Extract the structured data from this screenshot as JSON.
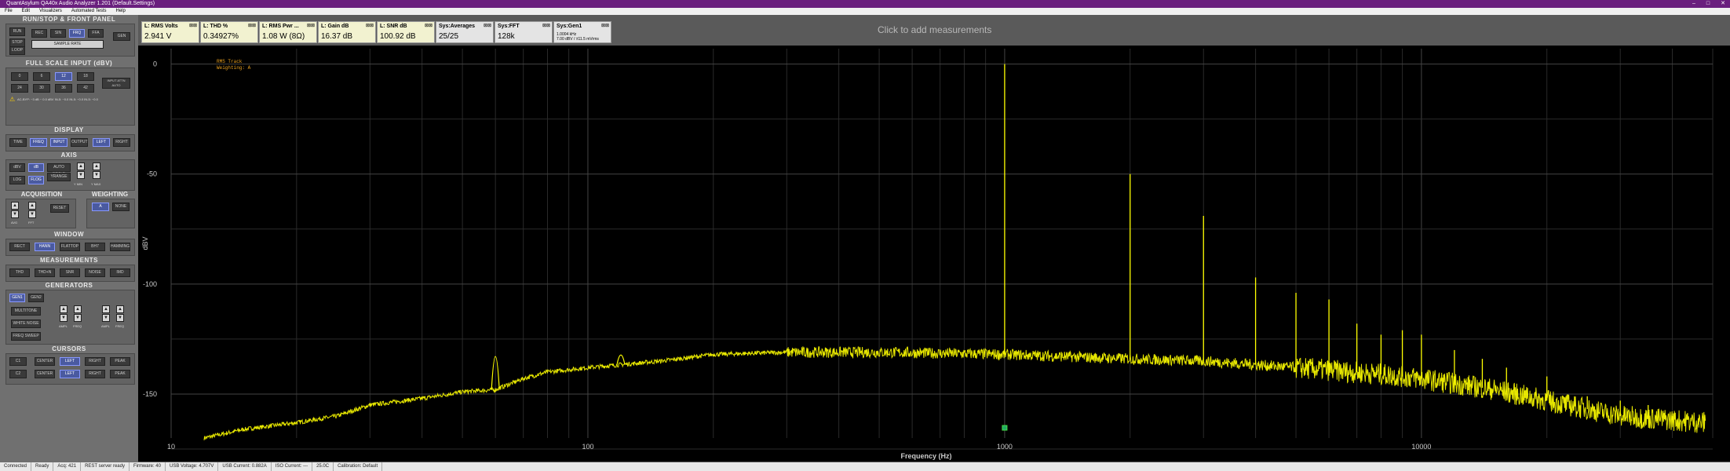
{
  "window": {
    "title": "QuantAsylum QA40x Audio Analyzer 1.201 (Default.Settings)",
    "controls": [
      "–",
      "□",
      "✕"
    ]
  },
  "menu": [
    "File",
    "Edit",
    "Visualizers",
    "Automated Tests",
    "Help"
  ],
  "left_panel": {
    "run_stop": {
      "title": "RUN/STOP & FRONT PANEL",
      "buttons": [
        "RUN",
        "REC",
        "SIN",
        "FRQ",
        "FFA",
        "GEN",
        "STOP",
        "LOOP"
      ],
      "sample_rate": "SAMPLE RATE"
    },
    "full_scale": {
      "title": "FULL SCALE INPUT (dBV)",
      "row1": [
        "0",
        "6",
        "12",
        "18"
      ],
      "row2": [
        "24",
        "30",
        "36",
        "42"
      ],
      "auto_label": "INPUT ATTN AUTO",
      "warning": "AC-BYP: ~3 dB ~ 0.0 dBV   IN-5: ~0.0   IN-5: ~0.0   IN-5: ~0.0"
    },
    "display": {
      "title": "DISPLAY",
      "buttons": [
        "TIME",
        "FREQ",
        "INPUT",
        "OUTPUT",
        "LEFT",
        "RIGHT"
      ]
    },
    "axis": {
      "title": "AXIS",
      "buttons": [
        "dBV",
        "dB",
        "LOG",
        "FLOG",
        "AUTO SCALE",
        "YRANGE"
      ],
      "spin_labels": [
        "Y MIN",
        "Y MAX"
      ]
    },
    "acquisition": {
      "title": "ACQUISITION",
      "buttons": [
        "RESET"
      ],
      "fields": [
        "AVG",
        "FFT"
      ]
    },
    "weighting": {
      "title": "WEIGHTING",
      "buttons": [
        "A",
        "NONE"
      ]
    },
    "window": {
      "title": "WINDOW",
      "buttons": [
        "RECT",
        "HANN",
        "FLATTOP",
        "BH7",
        "HAMMING"
      ]
    },
    "measurements": {
      "title": "MEASUREMENTS",
      "buttons": [
        "THD",
        "THD+N",
        "SNR",
        "NOISE",
        "IMD"
      ]
    },
    "generators": {
      "title": "GENERATORS",
      "buttons": [
        "GEN1",
        "GEN2",
        "MULTITONE",
        "WHITE NOISE",
        "FREQ SWEEP"
      ],
      "labels": [
        "AMPL",
        "FREQ",
        "AMPL",
        "FREQ"
      ]
    },
    "cursors": {
      "title": "CURSORS",
      "row1": [
        "C1",
        "CENTER",
        "LEFT",
        "RIGHT",
        "PEAK"
      ],
      "row2": [
        "C2",
        "CENTER",
        "LEFT",
        "RIGHT",
        "PEAK"
      ]
    }
  },
  "measurements": [
    {
      "title": "L: RMS Volts",
      "value": "2.941 V",
      "sys": false
    },
    {
      "title": "L: THD %",
      "value": "0.34927%",
      "sys": false
    },
    {
      "title": "L: RMS Pwr ...",
      "value": "1.08 W (8Ω)",
      "sys": false
    },
    {
      "title": "L: Gain dB",
      "value": "16.37 dB",
      "sys": false
    },
    {
      "title": "L: SNR dB",
      "value": "100.92 dB",
      "sys": false
    },
    {
      "title": "Sys:Averages",
      "value": "25/25",
      "sys": true
    },
    {
      "title": "Sys:FFT",
      "value": "128k",
      "sys": true
    },
    {
      "title": "Sys:Gen1",
      "value": "1.0004 kHz\n7.00 dBV / ±11.5 mVrms",
      "sys": true
    }
  ],
  "click_add": "Click to add measurements",
  "graph": {
    "legend_line1": "RMS Track",
    "legend_line2": "Weighting: A",
    "y_axis_label": "dBV",
    "x_axis_label": "Frequency (Hz)"
  },
  "chart_data": {
    "type": "line",
    "xlabel": "Frequency (Hz)",
    "ylabel": "dBV",
    "x_scale": "log",
    "xlim": [
      10,
      50000
    ],
    "ylim": [
      -170,
      7
    ],
    "x_ticks": [
      10,
      100,
      1000,
      10000
    ],
    "y_ticks": [
      0,
      -50,
      -100,
      -150
    ],
    "grid": true,
    "series_color": "#ffff00",
    "noise_floor": [
      [
        12,
        -170
      ],
      [
        15,
        -166
      ],
      [
        20,
        -163
      ],
      [
        25,
        -160
      ],
      [
        30,
        -155
      ],
      [
        40,
        -152
      ],
      [
        50,
        -149
      ],
      [
        60,
        -148
      ],
      [
        70,
        -143
      ],
      [
        80,
        -140
      ],
      [
        100,
        -138
      ],
      [
        150,
        -135
      ],
      [
        200,
        -132
      ],
      [
        300,
        -131
      ],
      [
        500,
        -131
      ],
      [
        1000,
        -132
      ],
      [
        2000,
        -134
      ],
      [
        3000,
        -135
      ],
      [
        5000,
        -138
      ],
      [
        8000,
        -141
      ],
      [
        10000,
        -143
      ],
      [
        15000,
        -148
      ],
      [
        20000,
        -153
      ],
      [
        30000,
        -160
      ],
      [
        48000,
        -163
      ]
    ],
    "peaks": [
      {
        "freq": 60,
        "level": -120
      },
      {
        "freq": 120,
        "level": -130
      },
      {
        "freq": 1000,
        "level": 0
      },
      {
        "freq": 2000,
        "level": -50
      },
      {
        "freq": 3000,
        "level": -69
      },
      {
        "freq": 4000,
        "level": -97
      },
      {
        "freq": 5000,
        "level": -104
      },
      {
        "freq": 6000,
        "level": -107
      },
      {
        "freq": 7000,
        "level": -118
      },
      {
        "freq": 8000,
        "level": -123
      },
      {
        "freq": 9000,
        "level": -121
      },
      {
        "freq": 10000,
        "level": -123
      },
      {
        "freq": 12000,
        "level": -130
      },
      {
        "freq": 14000,
        "level": -134
      },
      {
        "freq": 16000,
        "level": -138
      },
      {
        "freq": 20000,
        "level": -142
      },
      {
        "freq": 25000,
        "level": -151
      },
      {
        "freq": 30000,
        "level": -153
      },
      {
        "freq": 35000,
        "level": -155
      },
      {
        "freq": 40000,
        "level": -160
      }
    ]
  },
  "statusbar": [
    "Connected",
    "Ready",
    "Acq: 421",
    "REST server ready",
    "Firmware: 40",
    "USB Voltage: 4.707V",
    "USB Current: 0.882A",
    "ISO Current: ---",
    "25.0C",
    "Calibration: Default"
  ]
}
